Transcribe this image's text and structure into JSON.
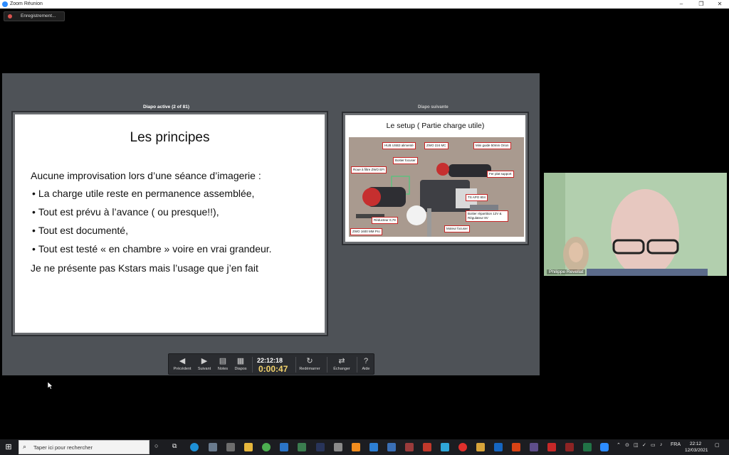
{
  "window": {
    "title": "Zoom Réunion",
    "minimize": "–",
    "maximize": "❐",
    "close": "✕"
  },
  "recording": {
    "label": "Enregistrement..."
  },
  "presenter": {
    "active_label": "Diapo active (2 of 81)",
    "next_label": "Diapo suivante",
    "current_slide": {
      "title": "Les principes",
      "intro": "Aucune improvisation lors d’une séance d’imagerie :",
      "bullets": [
        "La charge utile reste en permanence assemblée,",
        "Tout est prévu à l’avance ( ou presque!!),",
        "Tout est documenté,",
        "Tout est testé « en chambre » voire en vrai grandeur."
      ],
      "outro": "Je ne présente pas Kstars mais l’usage que j’en fait"
    },
    "next_slide": {
      "title": "Le setup ( Partie charge utile)",
      "callouts": [
        "HUB USB3 alimenté",
        "ZWO 224 MC",
        "Mini guide 50mm Orion",
        "Boitier focuser",
        "Roue à filtre ZWO EFI",
        "Fer plat support",
        "TS APO 804",
        "Boitier répartition 12V & Régulateur 8V",
        "Réducteur 0,79",
        "Moteur focuser",
        "ZWO 1600 MM Pro"
      ]
    }
  },
  "toolbar": {
    "prev": "Précédent",
    "next": "Suivant",
    "notes": "Notes",
    "slides": "Diapos",
    "clock": "22:12:18",
    "timer": "0:00:47",
    "restart": "Redémarrer",
    "swap": "Échanger",
    "help": "Aide"
  },
  "video": {
    "participant": "Philippe Revellat"
  },
  "taskbar": {
    "search_placeholder": "Taper ici pour rechercher",
    "lang": "FRA",
    "time": "22:12",
    "date": "12/03/2021"
  },
  "colors": {
    "accent_zoom": "#2d8cff",
    "timer": "#f3d36b",
    "callout_border": "#c82828"
  }
}
